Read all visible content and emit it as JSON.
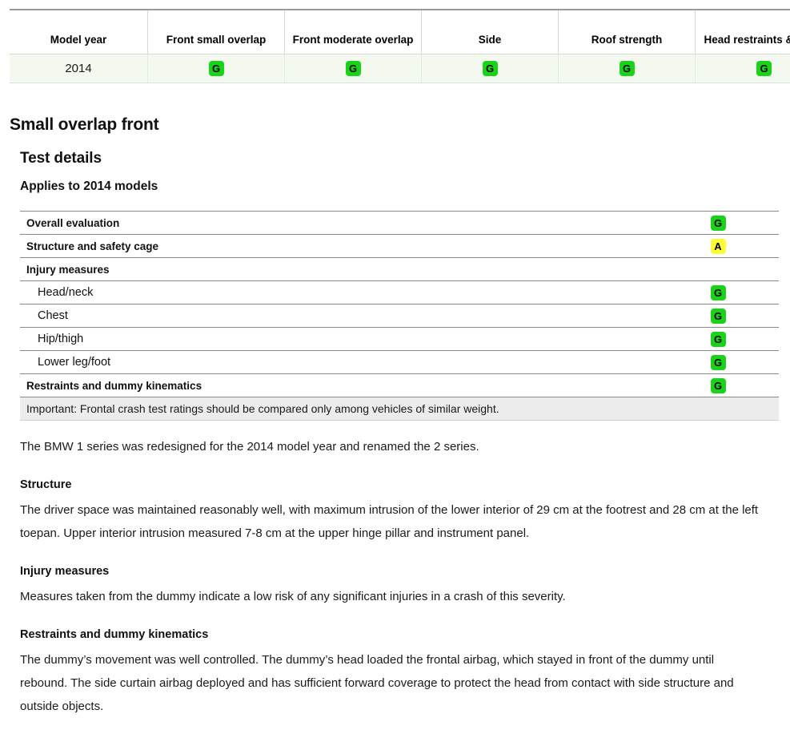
{
  "summary_table": {
    "columns": [
      "Model year",
      "Front small overlap",
      "Front moderate overlap",
      "Side",
      "Roof strength",
      "Head restraints & seats"
    ],
    "rows": [
      {
        "model_year": "2014",
        "front_small_overlap": "G",
        "front_moderate_overlap": "G",
        "side": "G",
        "roof_strength": "G",
        "head_restraints_seats": "G"
      }
    ]
  },
  "section": {
    "title": "Small overlap front",
    "test_details_heading": "Test details",
    "applies_to": "Applies to 2014 models"
  },
  "detail_ratings": {
    "rows": [
      {
        "label": "Overall evaluation",
        "rating": "G"
      },
      {
        "label": "Structure and safety cage",
        "rating": "A"
      },
      {
        "label": "Injury measures",
        "rating": ""
      },
      {
        "label": "Head/neck",
        "rating": "G"
      },
      {
        "label": "Chest",
        "rating": "G"
      },
      {
        "label": "Hip/thigh",
        "rating": "G"
      },
      {
        "label": "Lower leg/foot",
        "rating": "G"
      },
      {
        "label": "Restraints and dummy kinematics",
        "rating": "G"
      }
    ],
    "important_note": "Important: Frontal crash test ratings should be compared only among vehicles of similar weight."
  },
  "body": {
    "intro": "The BMW 1 series was redesigned for the 2014 model year and renamed the 2 series.",
    "structure_heading": "Structure",
    "structure_text": "The driver space was maintained reasonably well, with maximum intrusion of the lower interior of 29 cm at the footrest and 28 cm at the left toepan. Upper interior intrusion measured 7-8 cm at the upper hinge pillar and instrument panel.",
    "injury_heading": "Injury measures",
    "injury_text": "Measures taken from the dummy indicate a low risk of any significant injuries in a crash of this severity.",
    "restraints_heading": "Restraints and dummy kinematics",
    "restraints_text": "The dummy’s movement was well controlled. The dummy’s head loaded the frontal airbag, which stayed in front of the dummy until rebound. The side curtain airbag deployed and has sufficient forward coverage to protect the head from contact with side structure and outside objects."
  },
  "colors": {
    "good": "#19d319",
    "acceptable": "#fbfb36",
    "marginal": "#ffa31a",
    "poor": "#e8392e",
    "row_highlight": "#f4f9f0",
    "note_background": "#ececec"
  }
}
